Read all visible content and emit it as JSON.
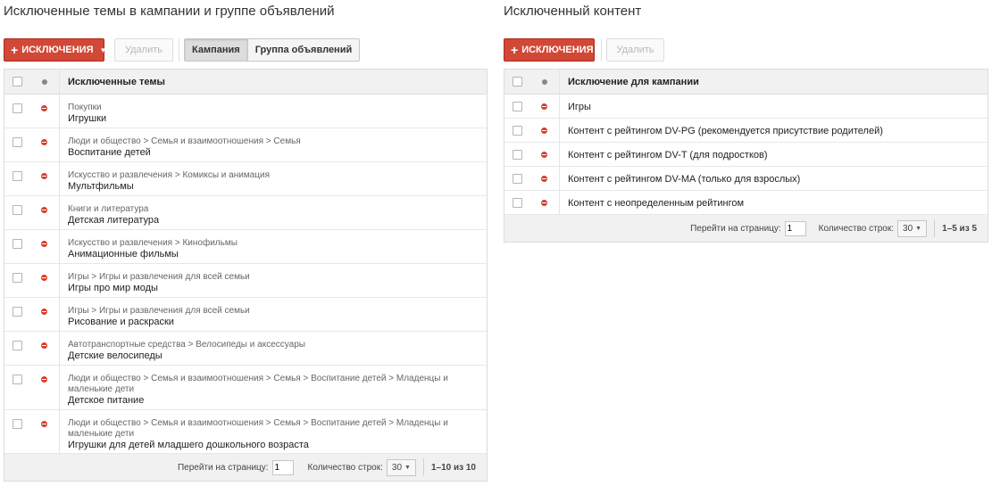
{
  "left": {
    "title": "Исключенные темы в кампании и группе объявлений",
    "add_label": "ИСКЛЮЧЕНИЯ",
    "delete_label": "Удалить",
    "seg": {
      "campaign": "Кампания",
      "adgroup": "Группа объявлений"
    },
    "header": "Исключенные темы",
    "rows": [
      {
        "path": "Покупки",
        "name": "Игрушки"
      },
      {
        "path": "Люди и общество > Семья и взаимоотношения > Семья",
        "name": "Воспитание детей"
      },
      {
        "path": "Искусство и развлечения > Комиксы и анимация",
        "name": "Мультфильмы"
      },
      {
        "path": "Книги и литература",
        "name": "Детская литература"
      },
      {
        "path": "Искусство и развлечения > Кинофильмы",
        "name": "Анимационные фильмы"
      },
      {
        "path": "Игры > Игры и развлечения для всей семьи",
        "name": "Игры про мир моды"
      },
      {
        "path": "Игры > Игры и развлечения для всей семьи",
        "name": "Рисование и раскраски"
      },
      {
        "path": "Автотранспортные средства > Велосипеды и аксессуары",
        "name": "Детские велосипеды"
      },
      {
        "path": "Люди и общество > Семья и взаимоотношения > Семья > Воспитание детей > Младенцы и маленькие дети",
        "name": "Детское питание"
      },
      {
        "path": "Люди и общество > Семья и взаимоотношения > Семья > Воспитание детей > Младенцы и маленькие дети",
        "name": "Игрушки для детей младшего дошкольного возраста"
      }
    ],
    "footer": {
      "goto_label": "Перейти на страницу:",
      "page": "1",
      "rows_label": "Количество строк:",
      "rows_value": "30",
      "range": "1–10 из 10"
    }
  },
  "right": {
    "title": "Исключенный контент",
    "add_label": "ИСКЛЮЧЕНИЯ",
    "delete_label": "Удалить",
    "header": "Исключение для кампании",
    "rows": [
      {
        "name": "Игры"
      },
      {
        "name": "Контент с рейтингом DV-PG (рекомендуется присутствие родителей)"
      },
      {
        "name": "Контент с рейтингом DV-T (для подростков)"
      },
      {
        "name": "Контент с рейтингом DV-MA (только для взрослых)"
      },
      {
        "name": "Контент с неопределенным рейтингом"
      }
    ],
    "footer": {
      "goto_label": "Перейти на страницу:",
      "page": "1",
      "rows_label": "Количество строк:",
      "rows_value": "30",
      "range": "1–5 из 5"
    }
  },
  "colors": {
    "add_button": "#d14836",
    "exclude_icon": "#d93b2b"
  },
  "icons": {
    "plus": "+",
    "caret": "▼",
    "exclude": "red-minus-circle-icon"
  }
}
